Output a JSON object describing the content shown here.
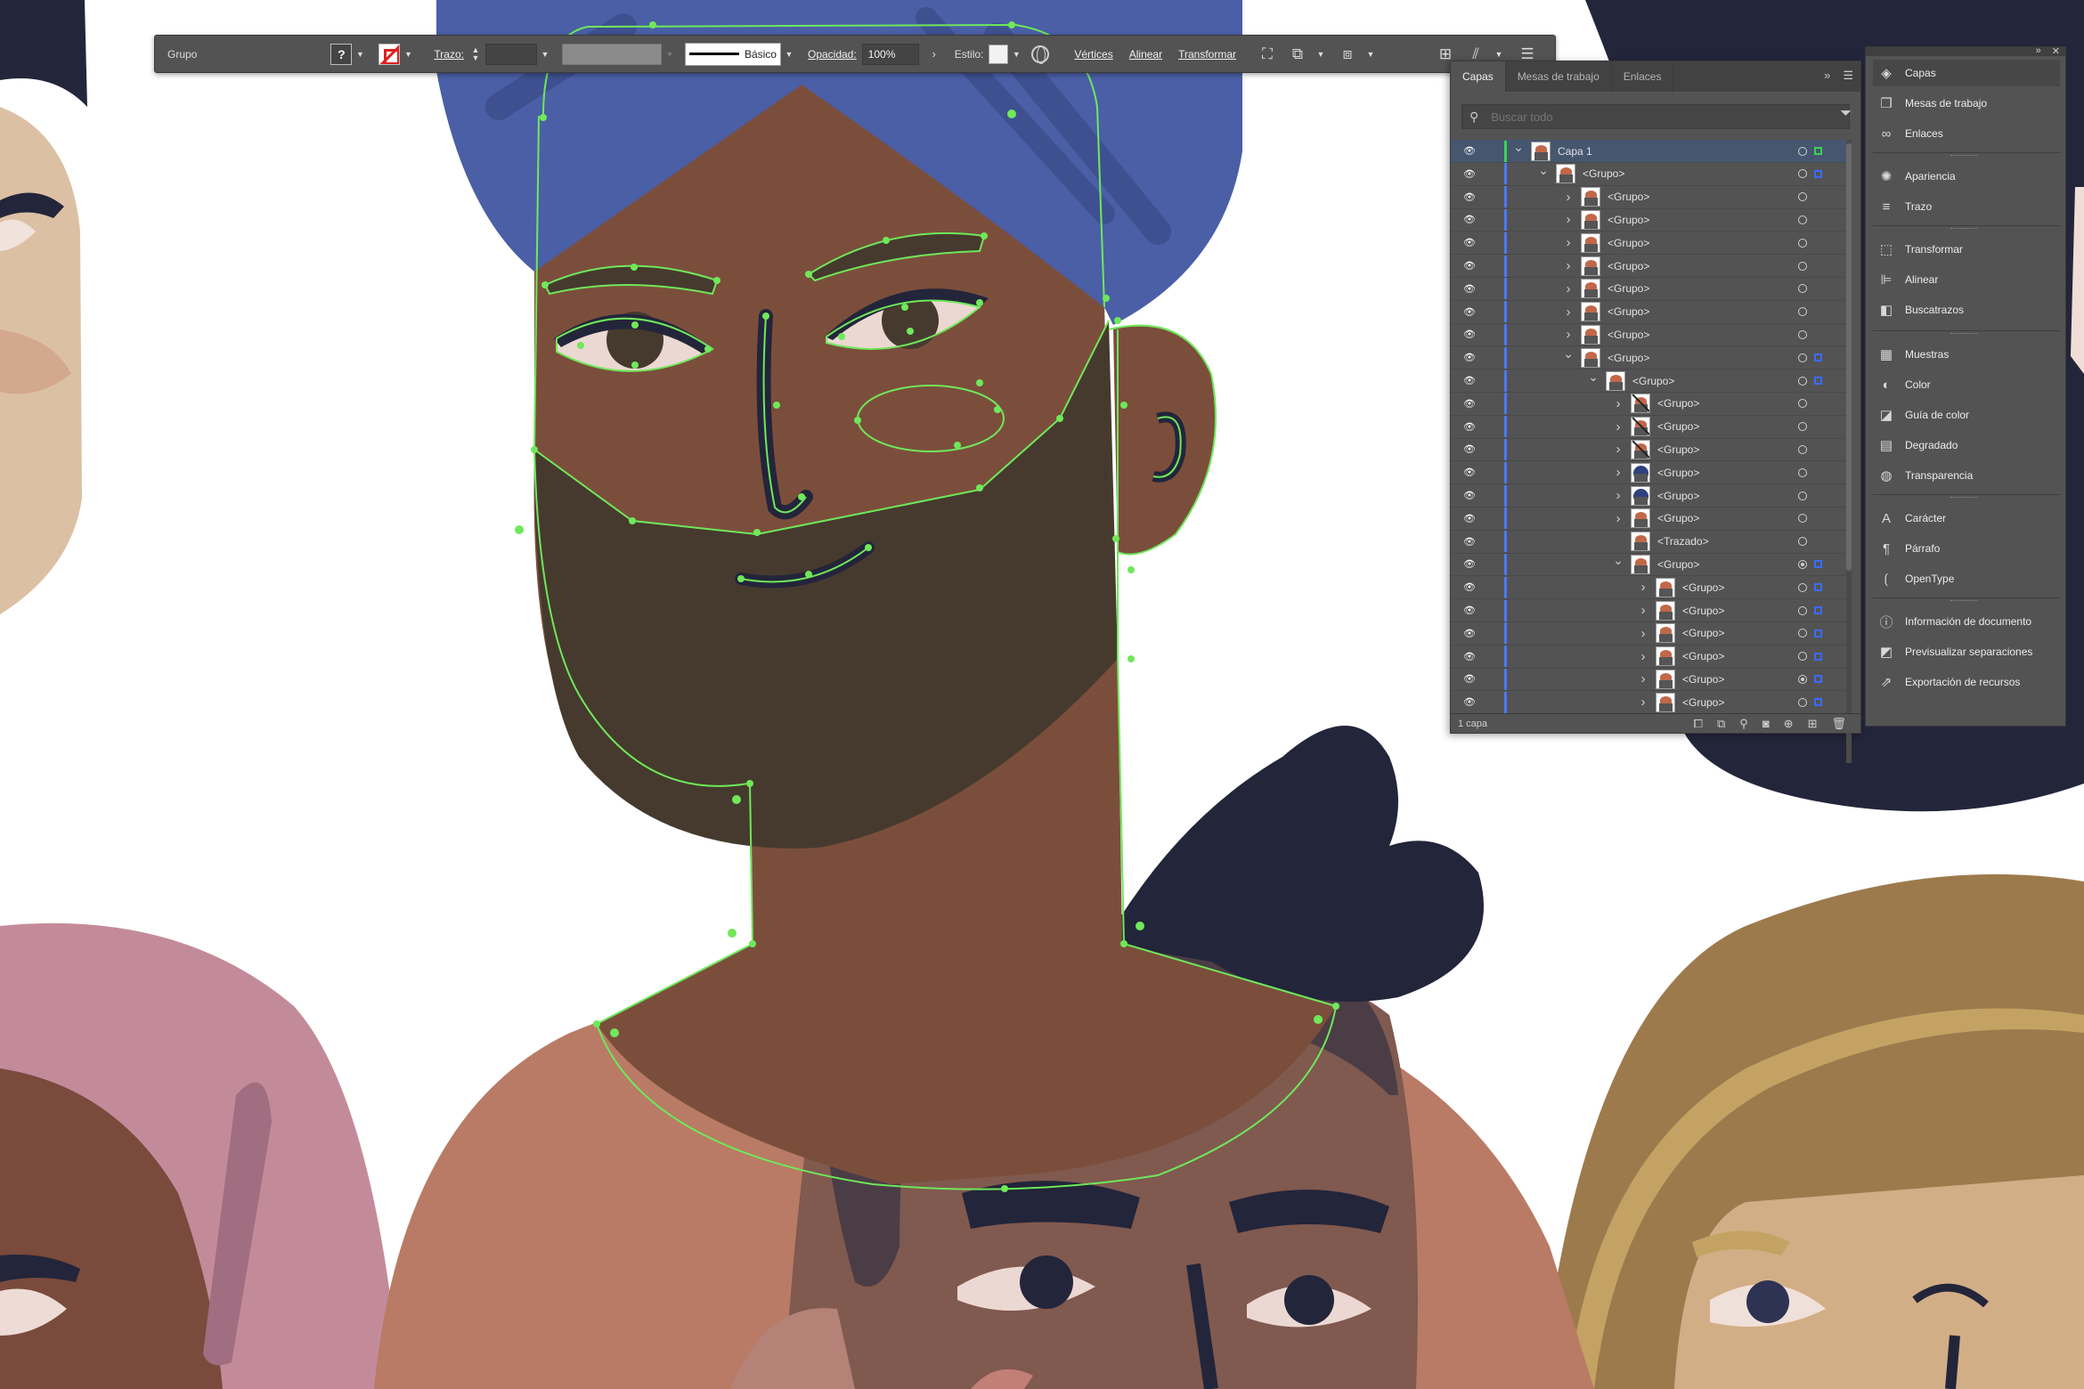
{
  "control_bar": {
    "selection": "Grupo",
    "fill_question": "?",
    "stroke_label": "Trazo:",
    "brush": "Básico",
    "opacity_label": "Opacidad:",
    "opacity_value": "100%",
    "style_label": "Estilo:",
    "vertices_label": "Vértices",
    "align_label": "Alinear",
    "transform_label": "Transformar"
  },
  "layers_panel": {
    "tabs": [
      "Capas",
      "Mesas de trabajo",
      "Enlaces"
    ],
    "search_placeholder": "Buscar todo",
    "rows": [
      {
        "name": "Capa 1",
        "indent": 0,
        "expanded": true,
        "selected": true
      },
      {
        "name": "<Grupo>",
        "indent": 1,
        "expanded": true
      },
      {
        "name": "<Grupo>",
        "indent": 2,
        "expanded": false
      },
      {
        "name": "<Grupo>",
        "indent": 2,
        "expanded": false
      },
      {
        "name": "<Grupo>",
        "indent": 2,
        "expanded": false
      },
      {
        "name": "<Grupo>",
        "indent": 2,
        "expanded": false
      },
      {
        "name": "<Grupo>",
        "indent": 2,
        "expanded": false
      },
      {
        "name": "<Grupo>",
        "indent": 2,
        "expanded": false
      },
      {
        "name": "<Grupo>",
        "indent": 2,
        "expanded": false
      },
      {
        "name": "<Grupo>",
        "indent": 2,
        "expanded": true
      },
      {
        "name": "<Grupo>",
        "indent": 3,
        "expanded": true
      },
      {
        "name": "<Grupo>",
        "indent": 4,
        "expanded": false
      },
      {
        "name": "<Grupo>",
        "indent": 4,
        "expanded": false
      },
      {
        "name": "<Grupo>",
        "indent": 4,
        "expanded": false
      },
      {
        "name": "<Grupo>",
        "indent": 4,
        "expanded": false
      },
      {
        "name": "<Grupo>",
        "indent": 4,
        "expanded": false
      },
      {
        "name": "<Grupo>",
        "indent": 4,
        "expanded": false
      },
      {
        "name": "<Trazado>",
        "indent": 4,
        "expanded": null
      },
      {
        "name": "<Grupo>",
        "indent": 4,
        "expanded": true
      },
      {
        "name": "<Grupo>",
        "indent": 5,
        "expanded": false
      },
      {
        "name": "<Grupo>",
        "indent": 5,
        "expanded": false
      },
      {
        "name": "<Grupo>",
        "indent": 5,
        "expanded": false
      },
      {
        "name": "<Grupo>",
        "indent": 5,
        "expanded": false
      },
      {
        "name": "<Grupo>",
        "indent": 5,
        "expanded": false
      },
      {
        "name": "<Grupo>",
        "indent": 5,
        "expanded": false
      }
    ],
    "footer": "1 capa"
  },
  "dock": {
    "items": [
      {
        "label": "Capas",
        "icon": "layers-icon",
        "glyph": "◈"
      },
      {
        "label": "Mesas de trabajo",
        "icon": "artboards-icon",
        "glyph": "❐"
      },
      {
        "label": "Enlaces",
        "icon": "links-icon",
        "glyph": "∞"
      },
      {
        "label": "Apariencia",
        "icon": "appearance-icon",
        "glyph": "✺"
      },
      {
        "label": "Trazo",
        "icon": "stroke-icon",
        "glyph": "≡"
      },
      {
        "label": "Transformar",
        "icon": "transform-icon",
        "glyph": "⬚"
      },
      {
        "label": "Alinear",
        "icon": "align-icon",
        "glyph": "⊫"
      },
      {
        "label": "Buscatrazos",
        "icon": "pathfinder-icon",
        "glyph": "◧"
      },
      {
        "label": "Muestras",
        "icon": "swatches-icon",
        "glyph": "▦"
      },
      {
        "label": "Color",
        "icon": "color-icon",
        "glyph": "◐"
      },
      {
        "label": "Guía de color",
        "icon": "color-guide-icon",
        "glyph": "◪"
      },
      {
        "label": "Degradado",
        "icon": "gradient-icon",
        "glyph": "▤"
      },
      {
        "label": "Transparencia",
        "icon": "transparency-icon",
        "glyph": "◍"
      },
      {
        "label": "Carácter",
        "icon": "character-icon",
        "glyph": "A"
      },
      {
        "label": "Párrafo",
        "icon": "paragraph-icon",
        "glyph": "¶"
      },
      {
        "label": "OpenType",
        "icon": "opentype-icon",
        "glyph": "⟮"
      },
      {
        "label": "Información de documento",
        "icon": "document-info-icon",
        "glyph": "ⓘ"
      },
      {
        "label": "Previsualizar separaciones",
        "icon": "separations-icon",
        "glyph": "◩"
      },
      {
        "label": "Exportación de recursos",
        "icon": "export-icon",
        "glyph": "⇗"
      }
    ]
  },
  "colors": {
    "turban": "#4a5fa6",
    "skin": "#7b4e3c",
    "beard": "#463a2e",
    "hair_dark": "#262a3e",
    "shirt": "#b87965",
    "selection_path": "#6fe85a",
    "panel_bg": "#535353"
  }
}
